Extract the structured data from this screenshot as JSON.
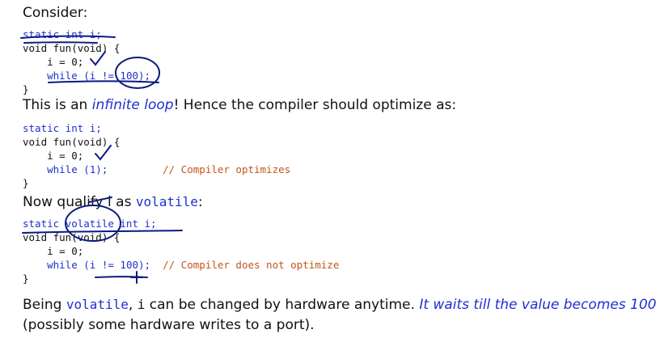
{
  "intro": "Consider:",
  "code1": {
    "line1": "static int i;",
    "line2": "void fun(void) {",
    "line3": "    i = 0;",
    "line4_kw": "    while",
    "line4_rest": " (i != 100);",
    "line5": "}"
  },
  "para2": {
    "before": "This is an ",
    "emph": "infinite loop",
    "after": "! Hence the compiler should optimize as:"
  },
  "code2": {
    "line1": "static int i;",
    "line2": "void fun(void) {",
    "line3": "    i = 0;",
    "line4_kw": "    while",
    "line4_rest": " (1);",
    "line4_pad": "         ",
    "line4_comment": "// Compiler optimizes",
    "line5": "}"
  },
  "para3": {
    "before": "Now qualify ",
    "var": "i",
    "mid": " as ",
    "keyword": "volatile",
    "after": ":"
  },
  "code3": {
    "line1": "static volatile int i;",
    "line2": "void fun(void) {",
    "line3": "    i = 0;",
    "line4_kw": "    while",
    "line4_rest": " (i != 100);",
    "line4_pad": "  ",
    "line4_comment": "// Compiler does not optimize",
    "line5": "}"
  },
  "para4": {
    "before": "Being ",
    "keyword": "volatile",
    "mid1": ", ",
    "var": "i",
    "mid2": " can be changed by hardware anytime. ",
    "emph": "It waits till the value becomes 100",
    "line2": "(possibly some hardware writes to a port)."
  }
}
